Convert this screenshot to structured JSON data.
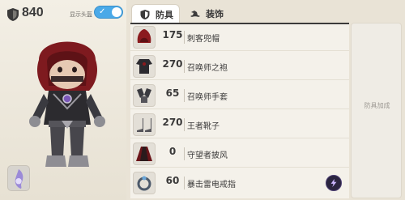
{
  "header": {
    "power_value": "840",
    "show_head_label": "显示头盔",
    "show_head_enabled": true
  },
  "tabs": [
    {
      "label": "防具",
      "icon": "shield-icon",
      "active": true
    },
    {
      "label": "装饰",
      "icon": "hat-icon",
      "active": false
    }
  ],
  "equipment": [
    {
      "count": "175",
      "name": "刺客兜帽",
      "icon": "hood-icon"
    },
    {
      "count": "270",
      "name": "召唤师之袍",
      "icon": "robe-icon"
    },
    {
      "count": "65",
      "name": "召唤师手套",
      "icon": "gloves-icon"
    },
    {
      "count": "270",
      "name": "王者靴子",
      "icon": "boots-icon"
    },
    {
      "count": "0",
      "name": "守望者披风",
      "icon": "cloak-icon"
    },
    {
      "count": "60",
      "name": "暴击雷电戒指",
      "icon": "ring-icon",
      "skill_icon": "lightning-icon"
    }
  ],
  "bonus_panel": {
    "label": "防具加成"
  },
  "colors": {
    "accent_blue": "#4aa9e8",
    "dark_text": "#3b3a3a",
    "hood_red": "#8b1a1e"
  }
}
